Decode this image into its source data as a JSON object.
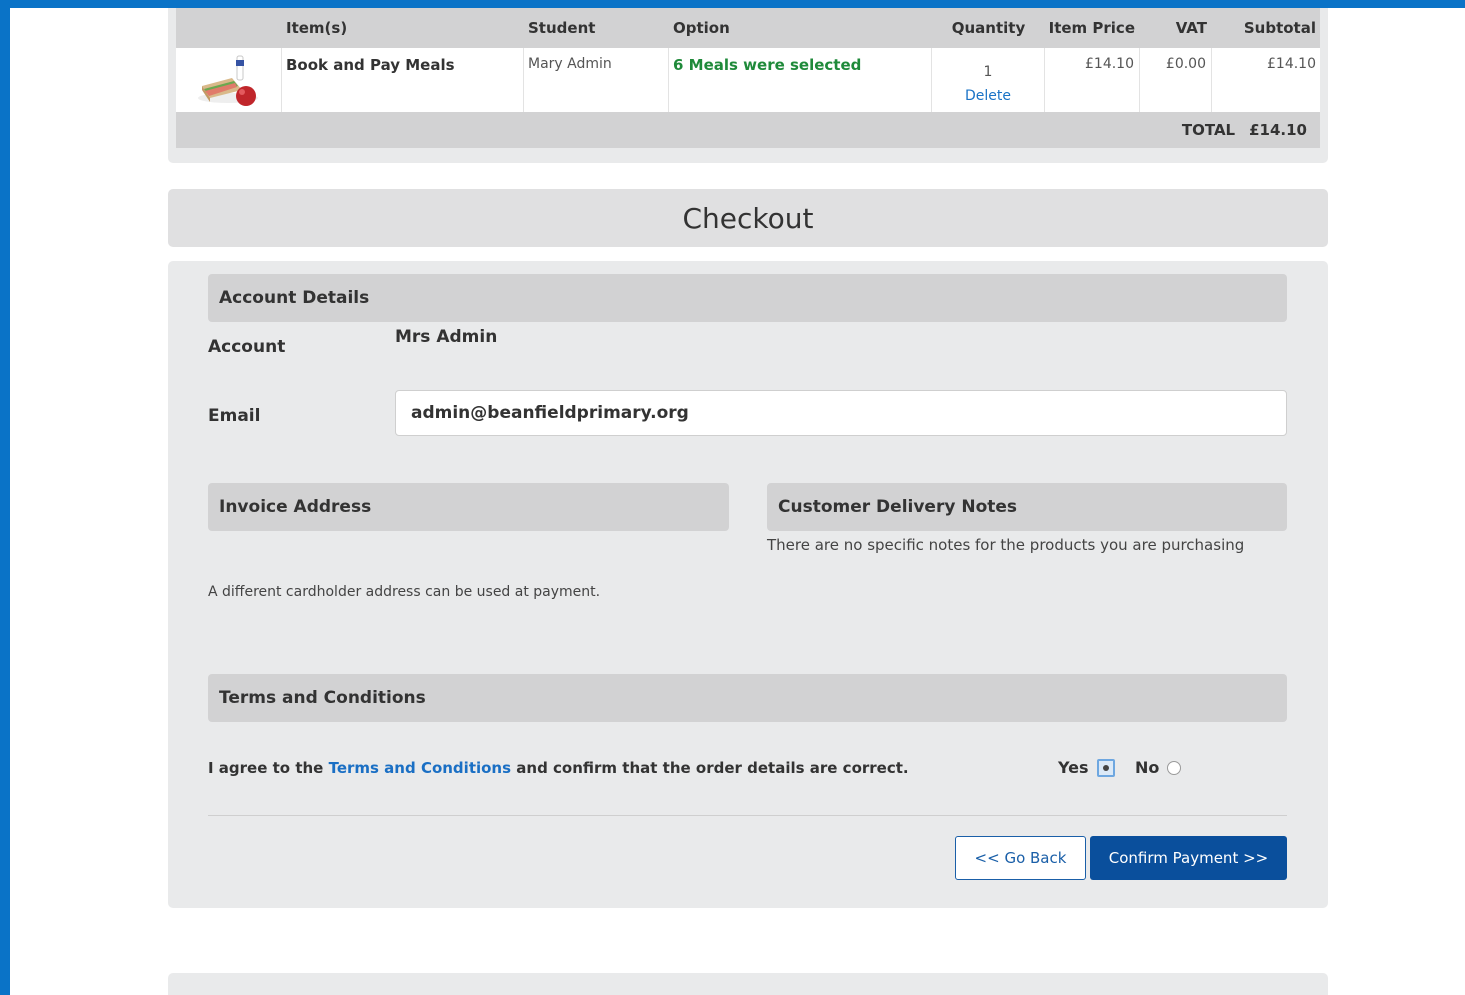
{
  "basket": {
    "headers": {
      "items": "Item(s)",
      "student": "Student",
      "option": "Option",
      "quantity": "Quantity",
      "item_price": "Item Price",
      "vat": "VAT",
      "subtotal": "Subtotal"
    },
    "row": {
      "image_icon": "meal-icon",
      "item": "Book and Pay Meals",
      "student": "Mary Admin",
      "option": "6 Meals were selected",
      "quantity": "1",
      "delete_label": "Delete",
      "item_price": "£14.10",
      "vat": "£0.00",
      "subtotal": "£14.10"
    },
    "total_label": "TOTAL",
    "total_value": "£14.10"
  },
  "checkout": {
    "title": "Checkout",
    "account_details": {
      "heading": "Account Details",
      "account_label": "Account",
      "account_value": "Mrs Admin",
      "email_label": "Email",
      "email_value": "admin@beanfieldprimary.org"
    },
    "invoice": {
      "heading": "Invoice Address",
      "note": "A different cardholder address can be used at payment."
    },
    "delivery": {
      "heading": "Customer Delivery Notes",
      "note": "There are no specific notes for the products you are purchasing"
    },
    "terms": {
      "heading": "Terms and Conditions",
      "agree_prefix": "I agree to the",
      "agree_link": "Terms and Conditions",
      "agree_suffix": "and confirm that the order details are correct.",
      "yes_label": "Yes",
      "no_label": "No",
      "selected": "Yes"
    },
    "buttons": {
      "back": "<< Go Back",
      "confirm": "Confirm Payment >>"
    }
  },
  "colors": {
    "frame": "#0a73c7",
    "option_green": "#1f8a3a",
    "link_blue": "#1a73c6",
    "confirm_button": "#0a4f9c"
  }
}
